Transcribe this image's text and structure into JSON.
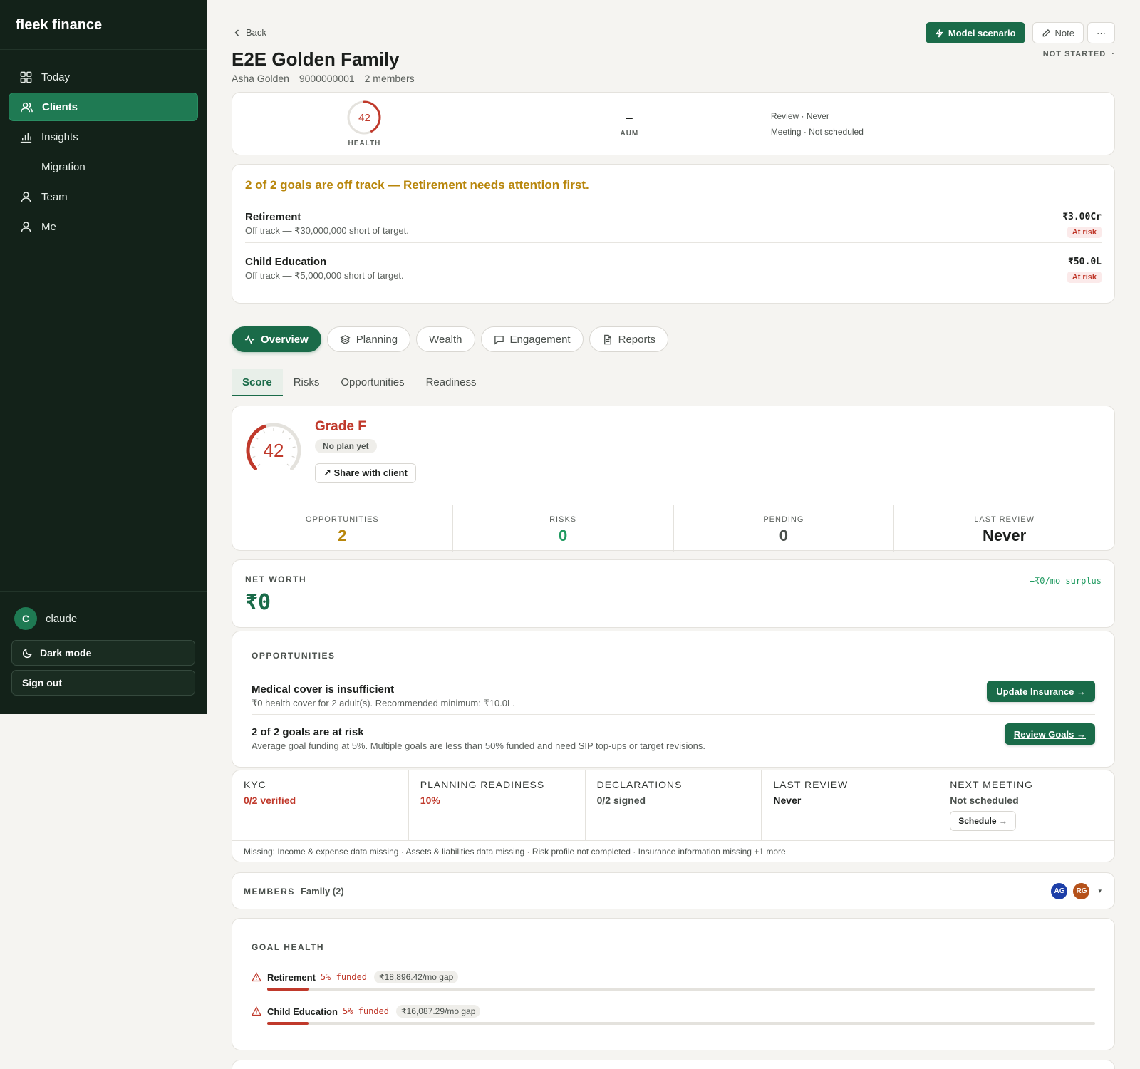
{
  "app": {
    "brand": "fleek finance"
  },
  "sidebar": {
    "items": [
      {
        "label": "Today",
        "icon": "grid-icon"
      },
      {
        "label": "Clients",
        "icon": "users-icon",
        "active": true
      },
      {
        "label": "Insights",
        "icon": "bar-chart-icon"
      },
      {
        "label": "Migration",
        "icon": ""
      },
      {
        "label": "Team",
        "icon": "user-icon"
      },
      {
        "label": "Me",
        "icon": "user-icon"
      }
    ],
    "user": {
      "initial": "C",
      "name": "claude"
    },
    "dark_mode_label": "Dark mode",
    "sign_out_label": "Sign out"
  },
  "header": {
    "back_label": "Back",
    "model_scenario_label": "Model scenario",
    "note_label": "Note",
    "more_label": "···",
    "status": "NOT STARTED",
    "status_dot": "·",
    "title": "E2E Golden Family",
    "primary_name": "Asha Golden",
    "phone": "9000000001",
    "members": "2 members"
  },
  "kpis": {
    "health_value": "42",
    "health_fraction": 0.42,
    "health_label": "HEALTH",
    "aum_value": "–",
    "aum_label": "AUM",
    "review": "Review · Never",
    "meeting": "Meeting · Not scheduled"
  },
  "alert": {
    "title": "2 of 2 goals are off track — Retirement needs attention first.",
    "goals": [
      {
        "name": "Retirement",
        "sub": "Off track — ₹30,000,000 short of target.",
        "amount": "₹3.00Cr",
        "badge": "At risk"
      },
      {
        "name": "Child Education",
        "sub": "Off track — ₹5,000,000 short of target.",
        "amount": "₹50.0L",
        "badge": "At risk"
      }
    ]
  },
  "tabs": [
    {
      "label": "Overview",
      "icon": "activity-icon",
      "active": true
    },
    {
      "label": "Planning",
      "icon": "layers-icon"
    },
    {
      "label": "Wealth",
      "icon": ""
    },
    {
      "label": "Engagement",
      "icon": "chat-icon"
    },
    {
      "label": "Reports",
      "icon": "document-icon"
    }
  ],
  "subtabs": [
    {
      "label": "Score",
      "active": true
    },
    {
      "label": "Risks"
    },
    {
      "label": "Opportunities"
    },
    {
      "label": "Readiness"
    }
  ],
  "score": {
    "value": "42",
    "fraction": 0.42,
    "grade": "Grade F",
    "plan_status": "No plan yet",
    "share_label": "↗ Share with client",
    "stats": [
      {
        "label": "OPPORTUNITIES",
        "value": "2",
        "color": "#b8860b"
      },
      {
        "label": "RISKS",
        "value": "0",
        "color": "#1f9a60"
      },
      {
        "label": "PENDING",
        "value": "0",
        "color": "#4a504c"
      },
      {
        "label": "LAST REVIEW",
        "value": "Never",
        "color": "#1c1f1d"
      }
    ]
  },
  "networth": {
    "label": "NET WORTH",
    "value": "₹0",
    "surplus": "+₹0/mo surplus"
  },
  "opportunities": {
    "label": "OPPORTUNITIES",
    "items": [
      {
        "title": "Medical cover is insufficient",
        "sub": "₹0 health cover for 2 adult(s). Recommended minimum: ₹10.0L.",
        "action": "Update Insurance →"
      },
      {
        "title": "2 of 2 goals are at risk",
        "sub": "Average goal funding at 5%. Multiple goals are less than 50% funded and need SIP top-ups or target revisions.",
        "action": "Review Goals →"
      }
    ]
  },
  "status_grid": {
    "cols": [
      {
        "label": "KYC",
        "value": "0/2 verified",
        "tone": "red"
      },
      {
        "label": "PLANNING READINESS",
        "value": "10%",
        "tone": "red"
      },
      {
        "label": "DECLARATIONS",
        "value": "0/2 signed",
        "tone": "muted"
      },
      {
        "label": "LAST REVIEW",
        "value": "Never",
        "tone": "dark"
      },
      {
        "label": "NEXT MEETING",
        "value": "Not scheduled",
        "tone": "muted",
        "action": "Schedule →"
      }
    ],
    "missing": "Missing: Income & expense data missing · Assets & liabilities data missing · Risk profile not completed · Insurance information missing +1 more"
  },
  "members": {
    "label": "MEMBERS",
    "family": "Family (2)",
    "avatars": [
      {
        "initials": "AG",
        "color": "#1d3fa8"
      },
      {
        "initials": "RG",
        "color": "#b5521b"
      }
    ],
    "caret": "▾"
  },
  "goal_health": {
    "label": "GOAL HEALTH",
    "goals": [
      {
        "name": "Retirement",
        "funded": "5% funded",
        "funded_fraction": 0.05,
        "gap": "₹18,896.42/mo gap"
      },
      {
        "name": "Child Education",
        "funded": "5% funded",
        "funded_fraction": 0.05,
        "gap": "₹16,087.29/mo gap"
      }
    ]
  }
}
